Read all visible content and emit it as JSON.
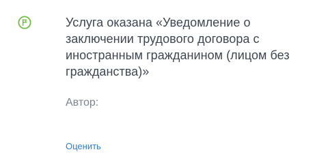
{
  "notification": {
    "icon": "flag-icon",
    "accent_color": "#6fbf3f",
    "message": "Услуга оказана «Уведомление о заключении трудового договора с иностранным гражданином (лицом без гражданства)»",
    "author_label": "Автор:",
    "rate_label": "Оценить",
    "link_color": "#2f7fd0"
  }
}
